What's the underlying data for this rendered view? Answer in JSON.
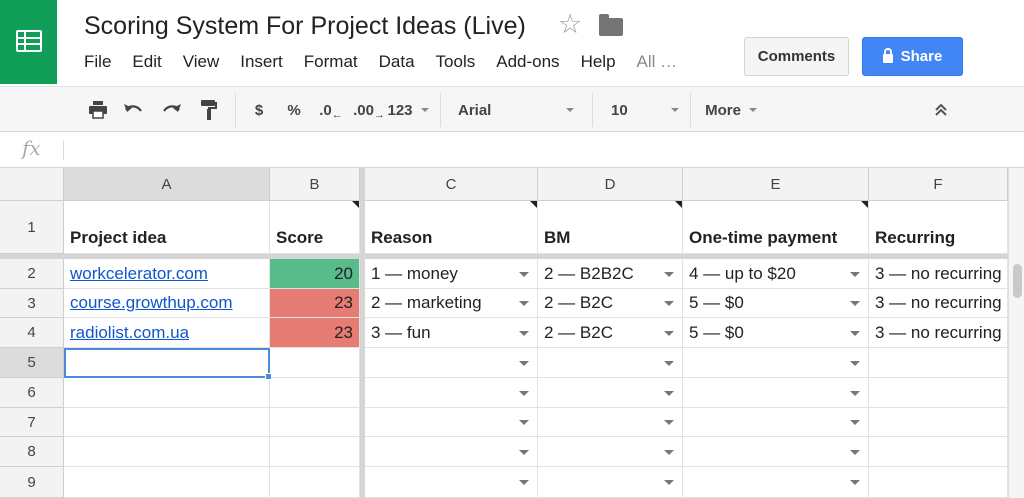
{
  "app": {
    "doc_title": "Scoring System For Project Ideas (Live)",
    "logo_icon": "sheets-logo-icon",
    "brand_color": "#0f9d58"
  },
  "menu": [
    "File",
    "Edit",
    "View",
    "Insert",
    "Format",
    "Data",
    "Tools",
    "Add-ons",
    "Help",
    "All …"
  ],
  "header_buttons": {
    "comments": "Comments",
    "share": "Share",
    "share_color": "#4285f4"
  },
  "toolbar": {
    "currency": "$",
    "percent": "%",
    "decrease_decimal": ".0",
    "increase_decimal": ".00",
    "number_format": "123",
    "font": "Arial",
    "font_size": "10",
    "more": "More"
  },
  "formula_bar": {
    "fx_label": "fx",
    "value": ""
  },
  "columns": [
    "A",
    "B",
    "C",
    "D",
    "E",
    "F"
  ],
  "rows": [
    "1",
    "2",
    "3",
    "4",
    "5",
    "6",
    "7",
    "8",
    "9"
  ],
  "header_row": [
    "Project idea",
    "Score",
    "Reason",
    "BM",
    "One-time payment",
    "Recurring"
  ],
  "data_rows": [
    {
      "project": "workcelerator.com",
      "score": "20",
      "score_color": "#57bb8a",
      "reason": "1 — money",
      "bm": "2 — B2B2C",
      "one_time": "4 — up to $20",
      "recurring": "3 — no recurring"
    },
    {
      "project": "course.growthup.com",
      "score": "23",
      "score_color": "#e67c73",
      "reason": "2 — marketing",
      "bm": "2 — B2C",
      "one_time": "5 — $0",
      "recurring": "3 — no recurring"
    },
    {
      "project": "radiolist.com.ua",
      "score": "23",
      "score_color": "#e67c73",
      "reason": "3 — fun",
      "bm": "2 — B2C",
      "one_time": "5 — $0",
      "recurring": "3 — no recurring"
    }
  ],
  "selection": {
    "active_cell": "A5"
  }
}
